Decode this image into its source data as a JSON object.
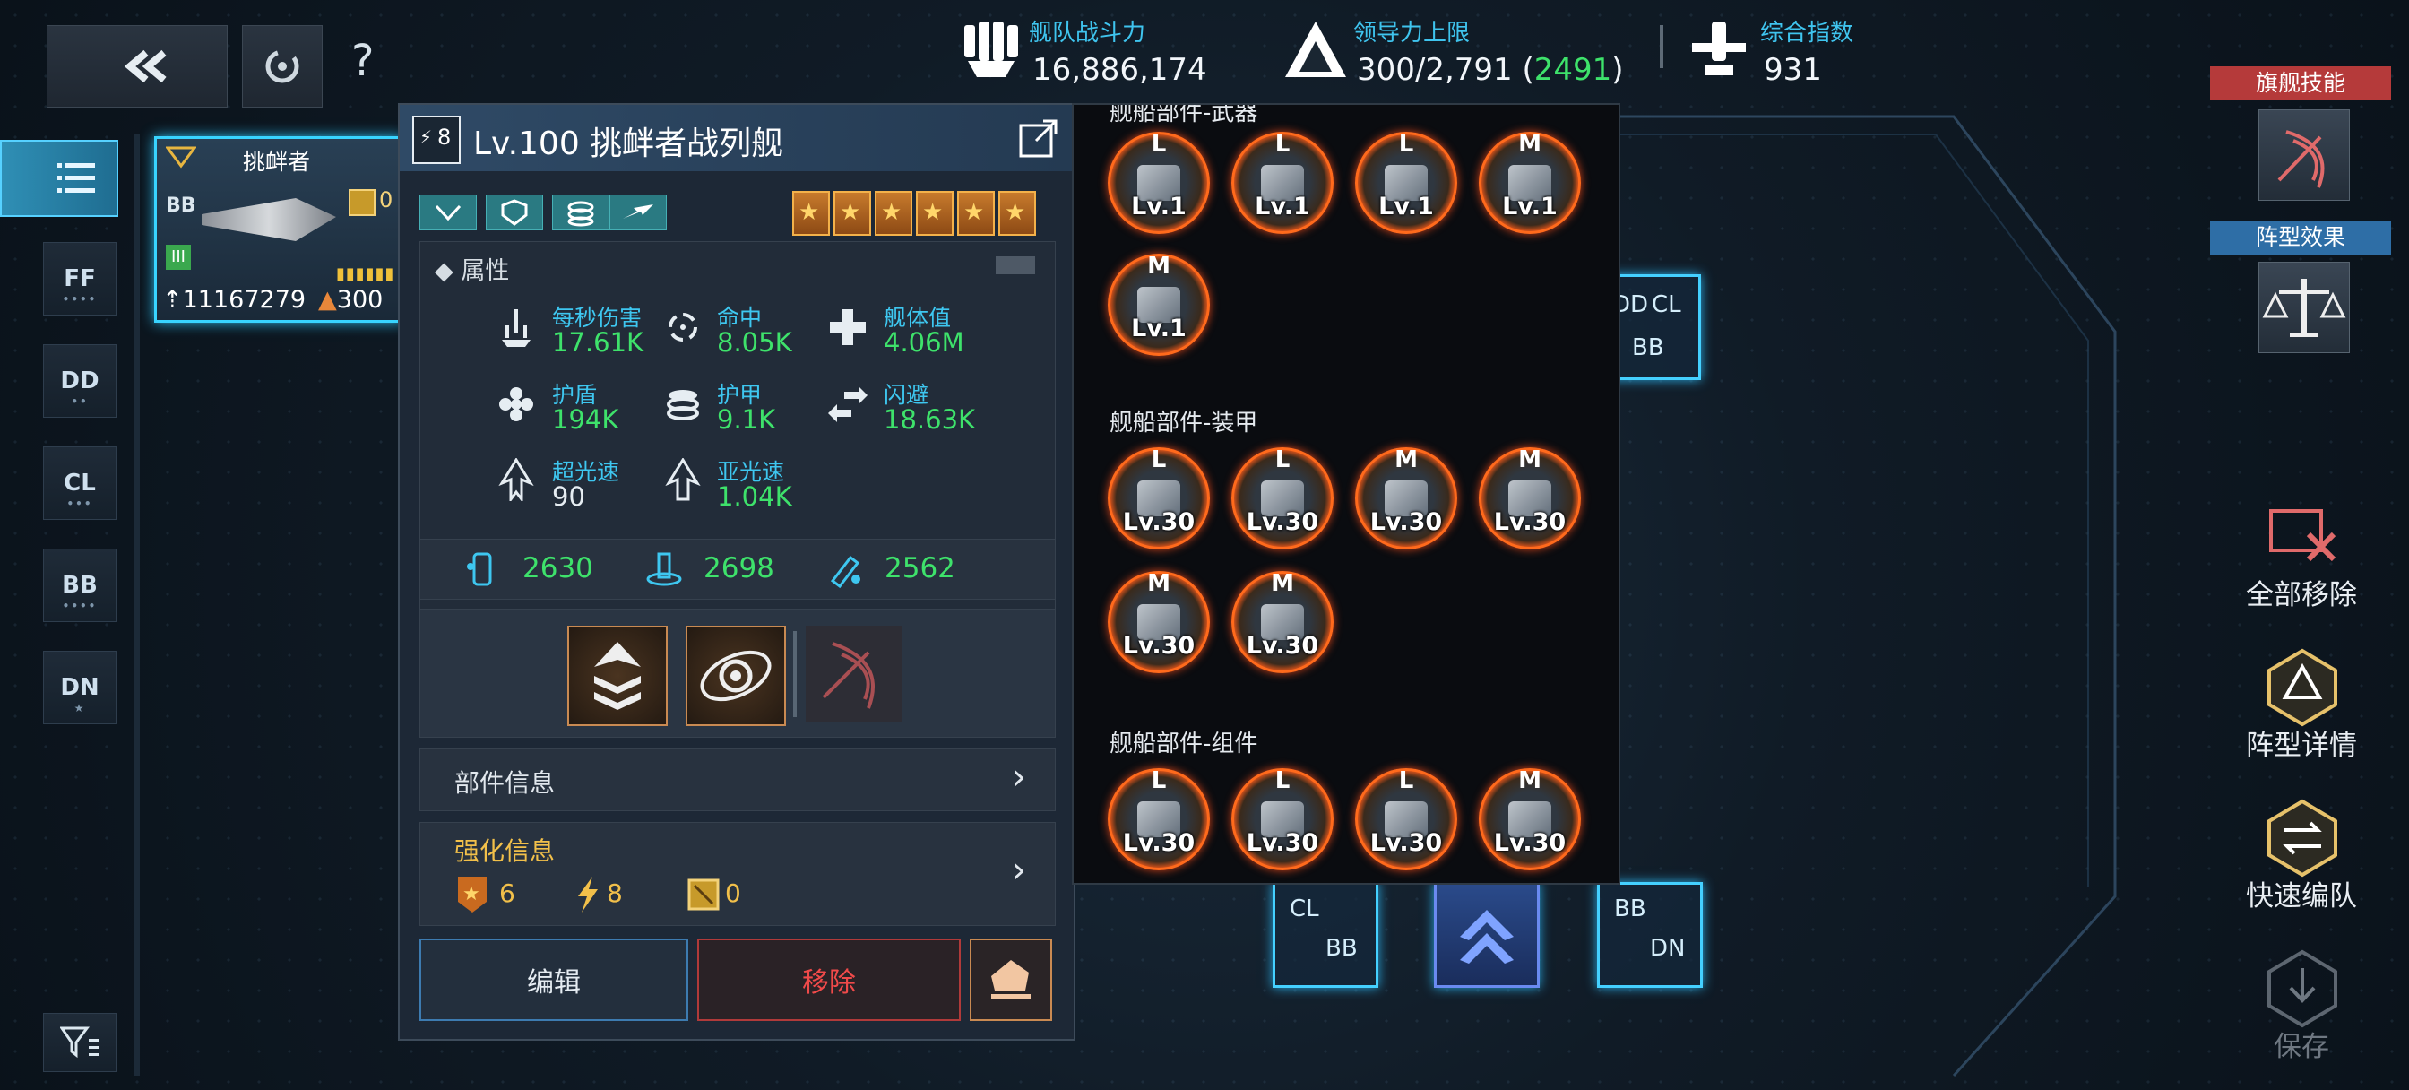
{
  "top_bar": {
    "back_icon": "double-chevron-left-icon",
    "settings_icon": "circle-refresh-icon",
    "help_label": "?",
    "fleet_power": {
      "label": "舰队战斗力",
      "value": "16,886,174"
    },
    "command_limit": {
      "label": "领导力上限",
      "value": "300/2,791 (",
      "highlight": "2491",
      "suffix": ")"
    },
    "composite_index": {
      "label": "综合指数",
      "value": "931"
    }
  },
  "left_nav": {
    "items": [
      {
        "label": "",
        "icon": "list-icon"
      },
      {
        "label": "FF",
        "sub": "••••"
      },
      {
        "label": "DD",
        "sub": "••"
      },
      {
        "label": "CL",
        "sub": "•••"
      },
      {
        "label": "BB",
        "sub": "••••"
      },
      {
        "label": "DN",
        "sub": "★"
      }
    ],
    "filter_icon": "filter-icon"
  },
  "ship_card": {
    "name": "挑衅者",
    "class": "BB",
    "chip_count": "0",
    "power": "11167279",
    "command": "300",
    "tier": "III"
  },
  "detail": {
    "rank": "8",
    "title": "Lv.100 挑衅者战列舰",
    "star_count": 6,
    "attributes_label": "属性",
    "attrs": [
      {
        "label": "每秒伤害",
        "value": "17.61K"
      },
      {
        "label": "命中",
        "value": "8.05K"
      },
      {
        "label": "舰体值",
        "value": "4.06M"
      },
      {
        "label": "护盾",
        "value": "194K"
      },
      {
        "label": "护甲",
        "value": "9.1K"
      },
      {
        "label": "闪避",
        "value": "18.63K"
      },
      {
        "label": "超光速",
        "value": "90"
      },
      {
        "label": "亚光速",
        "value": "1.04K"
      }
    ],
    "stats": [
      "2630",
      "2698",
      "2562"
    ],
    "parts_info": "部件信息",
    "enhance_info": "强化信息",
    "enhance": {
      "stars": "6",
      "bolts": "8",
      "chips": "0"
    },
    "edit_button": "编辑",
    "remove_button": "移除",
    "chevron": "›"
  },
  "parts": {
    "weapon_title": "舰船部件-武器",
    "armor_title": "舰船部件-装甲",
    "component_title": "舰船部件-组件",
    "weapons": [
      {
        "grade": "L",
        "level": "Lv.1"
      },
      {
        "grade": "L",
        "level": "Lv.1"
      },
      {
        "grade": "L",
        "level": "Lv.1"
      },
      {
        "grade": "M",
        "level": "Lv.1"
      },
      {
        "grade": "M",
        "level": "Lv.1"
      }
    ],
    "armor": [
      {
        "grade": "L",
        "level": "Lv.30"
      },
      {
        "grade": "L",
        "level": "Lv.30"
      },
      {
        "grade": "M",
        "level": "Lv.30"
      },
      {
        "grade": "M",
        "level": "Lv.30"
      },
      {
        "grade": "M",
        "level": "Lv.30"
      },
      {
        "grade": "M",
        "level": "Lv.30"
      }
    ],
    "components": [
      {
        "grade": "L",
        "level": "Lv.30"
      },
      {
        "grade": "L",
        "level": "Lv.30"
      },
      {
        "grade": "L",
        "level": "Lv.30"
      },
      {
        "grade": "M",
        "level": "Lv.30"
      }
    ]
  },
  "formation": {
    "tile_a": {
      "top": "DD",
      "right": "CL",
      "bottom": "BB"
    },
    "tile_b": {
      "top": "CL",
      "bottom": "BB"
    },
    "tile_c": {
      "top": "BB",
      "bottom": "DN"
    }
  },
  "right_panel": {
    "flagship_skill": "旗舰技能",
    "formation_effect": "阵型效果",
    "remove_all": "全部移除",
    "formation_detail": "阵型详情",
    "quick_form": "快速编队",
    "save": "保存"
  },
  "colors": {
    "accent_cyan": "#3fc4ee",
    "green": "#3ee26b",
    "red_button": "#e53b3b",
    "flagship_red": "#c13b3b",
    "formation_blue": "#2e6ea6"
  }
}
